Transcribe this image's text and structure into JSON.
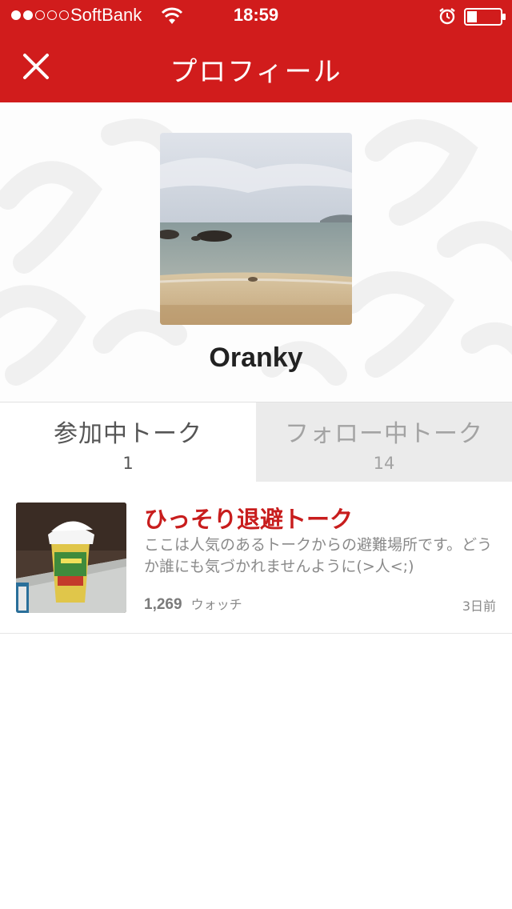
{
  "status_bar": {
    "signal_dots": [
      true,
      true,
      false,
      false,
      false
    ],
    "carrier": "SoftBank",
    "time": "18:59",
    "battery_level": 0.3
  },
  "nav": {
    "title": "プロフィール",
    "close_icon": "close-icon"
  },
  "profile": {
    "username": "Oranky"
  },
  "tabs": [
    {
      "label": "参加中トーク",
      "count": "1",
      "active": true
    },
    {
      "label": "フォロー中トーク",
      "count": "14",
      "active": false
    }
  ],
  "talks": [
    {
      "title": "ひっそり退避トーク",
      "description": "ここは人気のあるトークからの避難場所です。どうか誰にも気づかれませんように(>人<;)",
      "watch_count": "1,269",
      "watch_label": "ウォッチ",
      "date": "3日前"
    }
  ],
  "colors": {
    "brand": "#d11c1c",
    "talk_title": "#c81d1d",
    "inactive_tab": "#ebebeb"
  }
}
